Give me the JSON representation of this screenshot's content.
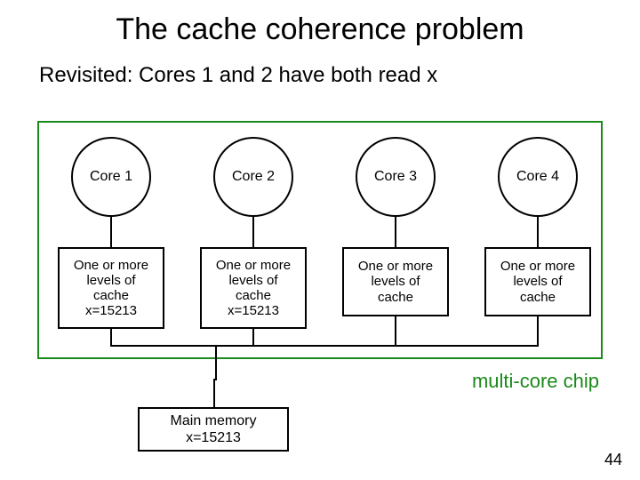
{
  "title": "The cache coherence problem",
  "subtitle": "Revisited: Cores 1 and 2 have both read x",
  "cores": {
    "c1": "Core 1",
    "c2": "Core 2",
    "c3": "Core 3",
    "c4": "Core 4"
  },
  "caches": {
    "base": "One or more\nlevels of\ncache",
    "withx_1": "One or more\nlevels of\ncache\nx=15213",
    "withx_2": "One or more\nlevels of\ncache\nx=15213"
  },
  "memory": "Main memory\nx=15213",
  "chip_label": "multi-core chip",
  "page_number": "44"
}
